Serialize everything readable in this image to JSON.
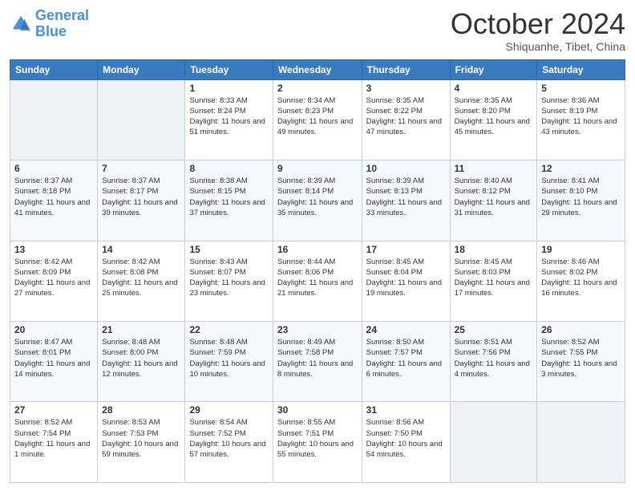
{
  "header": {
    "logo_line1": "General",
    "logo_line2": "Blue",
    "month": "October 2024",
    "location": "Shiquanhe, Tibet, China"
  },
  "days_of_week": [
    "Sunday",
    "Monday",
    "Tuesday",
    "Wednesday",
    "Thursday",
    "Friday",
    "Saturday"
  ],
  "weeks": [
    [
      {
        "day": "",
        "info": ""
      },
      {
        "day": "",
        "info": ""
      },
      {
        "day": "1",
        "info": "Sunrise: 8:33 AM\nSunset: 8:24 PM\nDaylight: 11 hours and 51 minutes."
      },
      {
        "day": "2",
        "info": "Sunrise: 8:34 AM\nSunset: 8:23 PM\nDaylight: 11 hours and 49 minutes."
      },
      {
        "day": "3",
        "info": "Sunrise: 8:35 AM\nSunset: 8:22 PM\nDaylight: 11 hours and 47 minutes."
      },
      {
        "day": "4",
        "info": "Sunrise: 8:35 AM\nSunset: 8:20 PM\nDaylight: 11 hours and 45 minutes."
      },
      {
        "day": "5",
        "info": "Sunrise: 8:36 AM\nSunset: 8:19 PM\nDaylight: 11 hours and 43 minutes."
      }
    ],
    [
      {
        "day": "6",
        "info": "Sunrise: 8:37 AM\nSunset: 8:18 PM\nDaylight: 11 hours and 41 minutes."
      },
      {
        "day": "7",
        "info": "Sunrise: 8:37 AM\nSunset: 8:17 PM\nDaylight: 11 hours and 39 minutes."
      },
      {
        "day": "8",
        "info": "Sunrise: 8:38 AM\nSunset: 8:15 PM\nDaylight: 11 hours and 37 minutes."
      },
      {
        "day": "9",
        "info": "Sunrise: 8:39 AM\nSunset: 8:14 PM\nDaylight: 11 hours and 35 minutes."
      },
      {
        "day": "10",
        "info": "Sunrise: 8:39 AM\nSunset: 8:13 PM\nDaylight: 11 hours and 33 minutes."
      },
      {
        "day": "11",
        "info": "Sunrise: 8:40 AM\nSunset: 8:12 PM\nDaylight: 11 hours and 31 minutes."
      },
      {
        "day": "12",
        "info": "Sunrise: 8:41 AM\nSunset: 8:10 PM\nDaylight: 11 hours and 29 minutes."
      }
    ],
    [
      {
        "day": "13",
        "info": "Sunrise: 8:42 AM\nSunset: 8:09 PM\nDaylight: 11 hours and 27 minutes."
      },
      {
        "day": "14",
        "info": "Sunrise: 8:42 AM\nSunset: 8:08 PM\nDaylight: 11 hours and 25 minutes."
      },
      {
        "day": "15",
        "info": "Sunrise: 8:43 AM\nSunset: 8:07 PM\nDaylight: 11 hours and 23 minutes."
      },
      {
        "day": "16",
        "info": "Sunrise: 8:44 AM\nSunset: 8:06 PM\nDaylight: 11 hours and 21 minutes."
      },
      {
        "day": "17",
        "info": "Sunrise: 8:45 AM\nSunset: 8:04 PM\nDaylight: 11 hours and 19 minutes."
      },
      {
        "day": "18",
        "info": "Sunrise: 8:45 AM\nSunset: 8:03 PM\nDaylight: 11 hours and 17 minutes."
      },
      {
        "day": "19",
        "info": "Sunrise: 8:46 AM\nSunset: 8:02 PM\nDaylight: 11 hours and 16 minutes."
      }
    ],
    [
      {
        "day": "20",
        "info": "Sunrise: 8:47 AM\nSunset: 8:01 PM\nDaylight: 11 hours and 14 minutes."
      },
      {
        "day": "21",
        "info": "Sunrise: 8:48 AM\nSunset: 8:00 PM\nDaylight: 11 hours and 12 minutes."
      },
      {
        "day": "22",
        "info": "Sunrise: 8:48 AM\nSunset: 7:59 PM\nDaylight: 11 hours and 10 minutes."
      },
      {
        "day": "23",
        "info": "Sunrise: 8:49 AM\nSunset: 7:58 PM\nDaylight: 11 hours and 8 minutes."
      },
      {
        "day": "24",
        "info": "Sunrise: 8:50 AM\nSunset: 7:57 PM\nDaylight: 11 hours and 6 minutes."
      },
      {
        "day": "25",
        "info": "Sunrise: 8:51 AM\nSunset: 7:56 PM\nDaylight: 11 hours and 4 minutes."
      },
      {
        "day": "26",
        "info": "Sunrise: 8:52 AM\nSunset: 7:55 PM\nDaylight: 11 hours and 3 minutes."
      }
    ],
    [
      {
        "day": "27",
        "info": "Sunrise: 8:52 AM\nSunset: 7:54 PM\nDaylight: 11 hours and 1 minute."
      },
      {
        "day": "28",
        "info": "Sunrise: 8:53 AM\nSunset: 7:53 PM\nDaylight: 10 hours and 59 minutes."
      },
      {
        "day": "29",
        "info": "Sunrise: 8:54 AM\nSunset: 7:52 PM\nDaylight: 10 hours and 57 minutes."
      },
      {
        "day": "30",
        "info": "Sunrise: 8:55 AM\nSunset: 7:51 PM\nDaylight: 10 hours and 55 minutes."
      },
      {
        "day": "31",
        "info": "Sunrise: 8:56 AM\nSunset: 7:50 PM\nDaylight: 10 hours and 54 minutes."
      },
      {
        "day": "",
        "info": ""
      },
      {
        "day": "",
        "info": ""
      }
    ]
  ]
}
